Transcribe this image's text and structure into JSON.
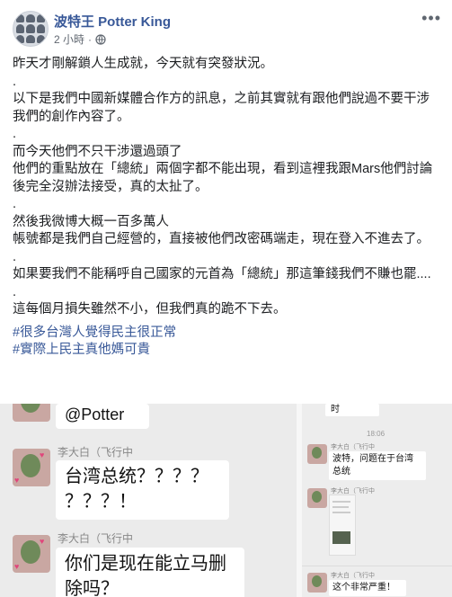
{
  "post": {
    "author": "波特王 Potter King",
    "time": "2 小時",
    "lines": [
      "昨天才剛解鎖人生成就，今天就有突發狀況。",
      ".",
      "以下是我們中國新媒體合作方的訊息，之前其實就有跟他們說過不要干涉我們的創作內容了。",
      ".",
      "而今天他們不只干涉還過頭了",
      "他們的重點放在「總統」兩個字都不能出現，看到這裡我跟Mars他們討論後完全沒辦法接受，真的太扯了。",
      ".",
      "然後我微博大概一百多萬人",
      "帳號都是我們自己經營的，直接被他們改密碼端走，現在登入不進去了。",
      ".",
      "如果要我們不能稱呼自己國家的元首為「總統」那這筆錢我們不賺也罷....",
      ".",
      "這每個月損失雖然不小，但我們真的跪不下去。"
    ],
    "hashtags": [
      "#很多台灣人覺得民主很正常",
      "#實際上民主真他媽可貴"
    ]
  },
  "chat_left": {
    "top_bubble": "@Potter",
    "messages": [
      {
        "sender": "李大白（飞行中",
        "text_line1": "台湾总统？？？？",
        "text_line2": "？？？！"
      },
      {
        "sender": "李大白（飞行中",
        "text_line1": "你们是现在能立马删",
        "text_line2": "除吗？"
      }
    ]
  },
  "chat_right": {
    "top_fragment": "时",
    "timestamp": "18:06",
    "messages": [
      {
        "sender": "李大白（飞行中",
        "text_line1": "波特，问题在于台湾",
        "text_line2": "总统"
      },
      {
        "sender": "李大白（飞行中"
      },
      {
        "sender": "李大白（飞行中",
        "text_line1": "这个非常严重！"
      }
    ]
  }
}
